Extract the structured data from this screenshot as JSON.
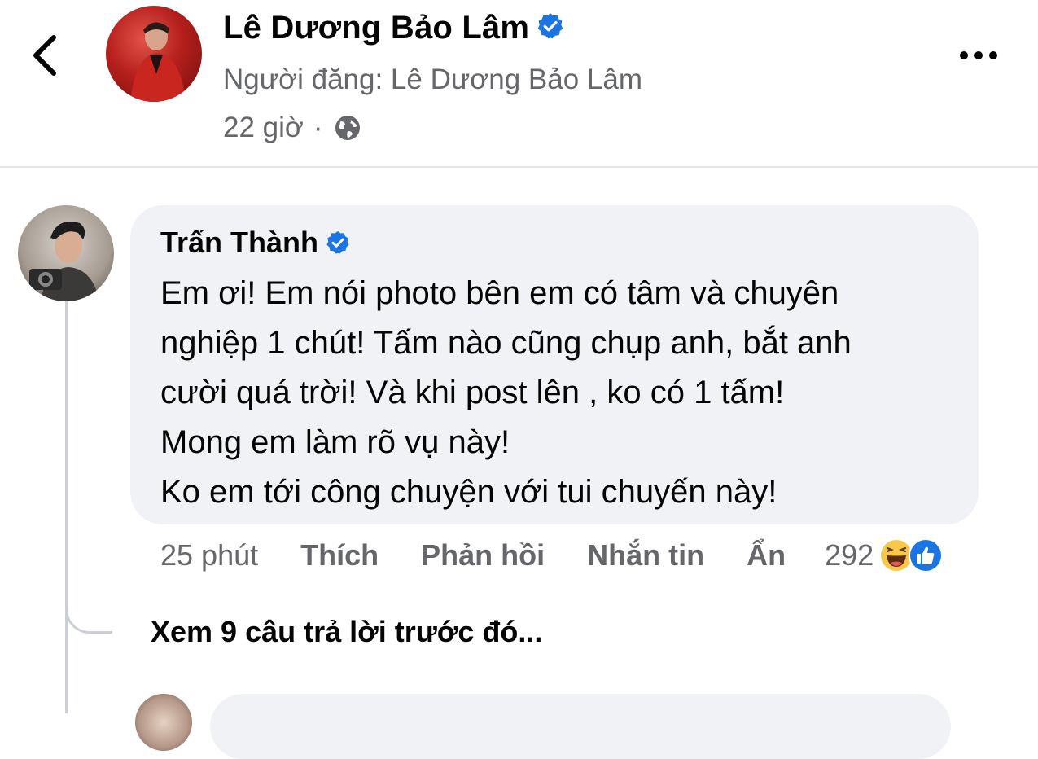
{
  "post": {
    "author_name": "Lê Dương Bảo Lâm",
    "poster_line": "Người đăng: Lê Dương Bảo Lâm",
    "time": "22 giờ",
    "separator": "·",
    "audience_icon": "globe-icon",
    "more_icon": "more-options-icon",
    "back_icon": "back-chevron-icon",
    "verified_icon": "verified-badge-icon"
  },
  "comment": {
    "author_name": "Trấn Thành",
    "verified_icon": "verified-badge-icon",
    "text_lines": [
      "Em ơi! Em nói photo bên em có tâm và chuyên",
      "nghiệp 1 chút! Tấm nào cũng chụp anh, bắt anh",
      "cười quá trời! Và khi post lên , ko có 1 tấm!",
      "Mong em làm rõ vụ này!",
      "Ko em tới công chuyện với tui chuyến này!"
    ],
    "time": "25 phút",
    "like_label": "Thích",
    "reply_label": "Phản hồi",
    "message_label": "Nhắn tin",
    "hide_label": "Ẩn",
    "reaction_count": "292",
    "reaction_icons": [
      "haha-reaction-icon",
      "like-reaction-icon"
    ]
  },
  "replies": {
    "view_previous_label": "Xem 9 câu trả lời trước đó..."
  },
  "colors": {
    "secondary_text": "#65676b",
    "bubble_bg": "#f0f2f5",
    "verified_blue": "#1b74e4",
    "divider": "#e4e6eb"
  }
}
